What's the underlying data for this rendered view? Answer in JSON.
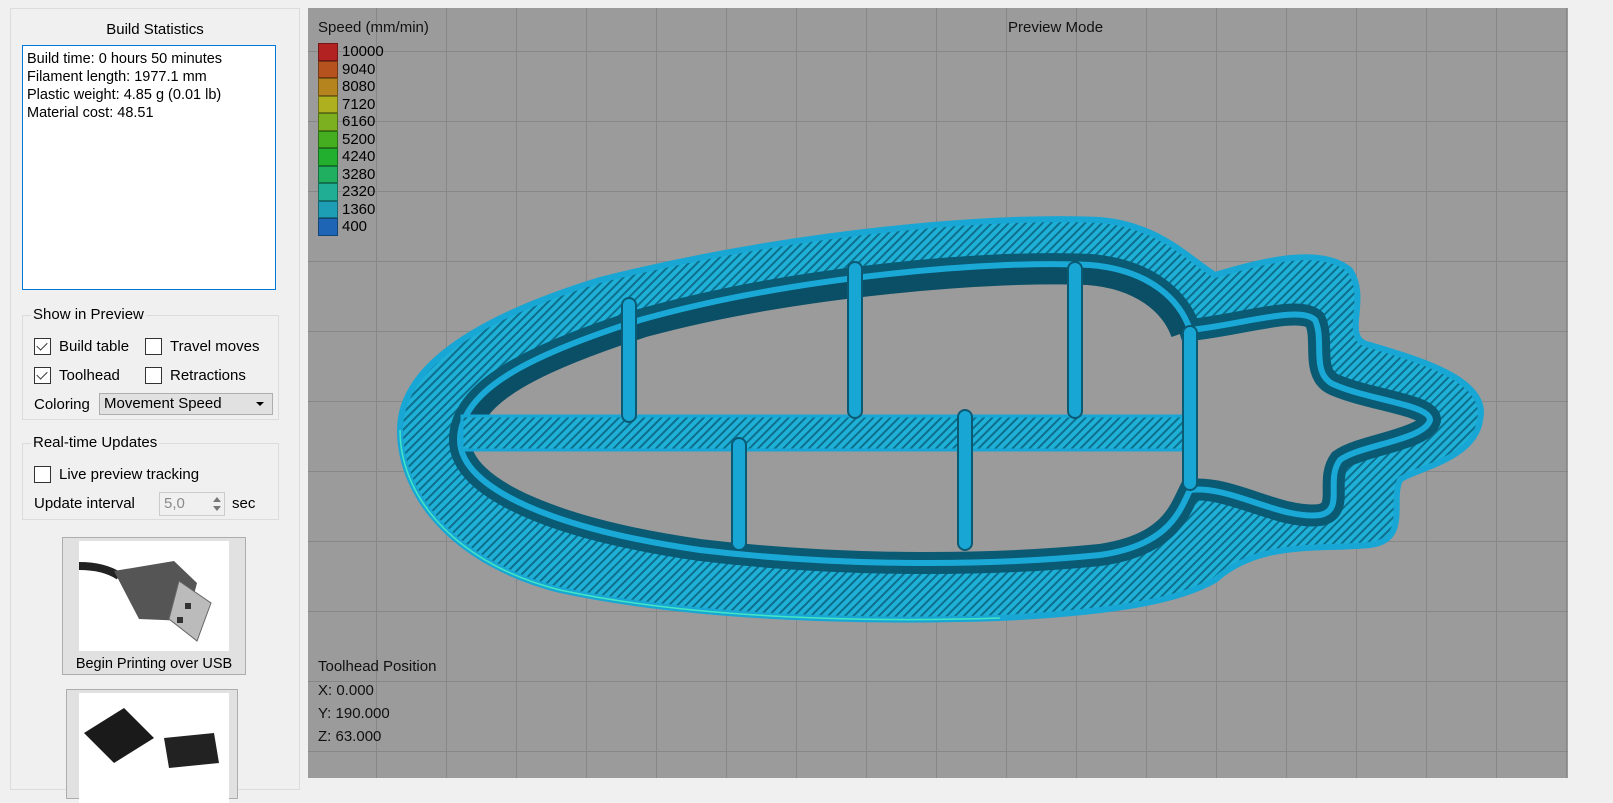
{
  "panel": {
    "title": "Build Statistics",
    "stats": [
      "Build time: 0 hours 50 minutes",
      "Filament length: 1977.1 mm",
      "Plastic weight: 4.85 g (0.01 lb)",
      "Material cost: 48.51"
    ],
    "show_in_preview": {
      "label": "Show in Preview",
      "build_table": {
        "label": "Build table",
        "checked": true
      },
      "travel_moves": {
        "label": "Travel moves",
        "checked": false
      },
      "toolhead": {
        "label": "Toolhead",
        "checked": true
      },
      "retractions": {
        "label": "Retractions",
        "checked": false
      },
      "coloring_label": "Coloring",
      "coloring_value": "Movement Speed"
    },
    "realtime": {
      "label": "Real-time Updates",
      "live_tracking": {
        "label": "Live preview tracking",
        "checked": false
      },
      "interval_label": "Update interval",
      "interval_value": "5,0",
      "interval_unit": "sec"
    },
    "usb_button": "Begin Printing over USB"
  },
  "viewport": {
    "mode": "Preview Mode",
    "legend": {
      "title": "Speed (mm/min)",
      "items": [
        {
          "value": "10000",
          "color": "#b22222"
        },
        {
          "value": "9040",
          "color": "#b5521e"
        },
        {
          "value": "8080",
          "color": "#b5841e"
        },
        {
          "value": "7120",
          "color": "#aeb020"
        },
        {
          "value": "6160",
          "color": "#7db020"
        },
        {
          "value": "5200",
          "color": "#44ae20"
        },
        {
          "value": "4240",
          "color": "#22ae2e"
        },
        {
          "value": "3280",
          "color": "#20ae60"
        },
        {
          "value": "2320",
          "color": "#20ae94"
        },
        {
          "value": "1360",
          "color": "#1e9eb5"
        },
        {
          "value": "400",
          "color": "#1e66b5"
        }
      ]
    },
    "toolhead": {
      "title": "Toolhead Position",
      "x": "X: 0.000",
      "y": "Y: 190.000",
      "z": "Z: 63.000"
    }
  }
}
